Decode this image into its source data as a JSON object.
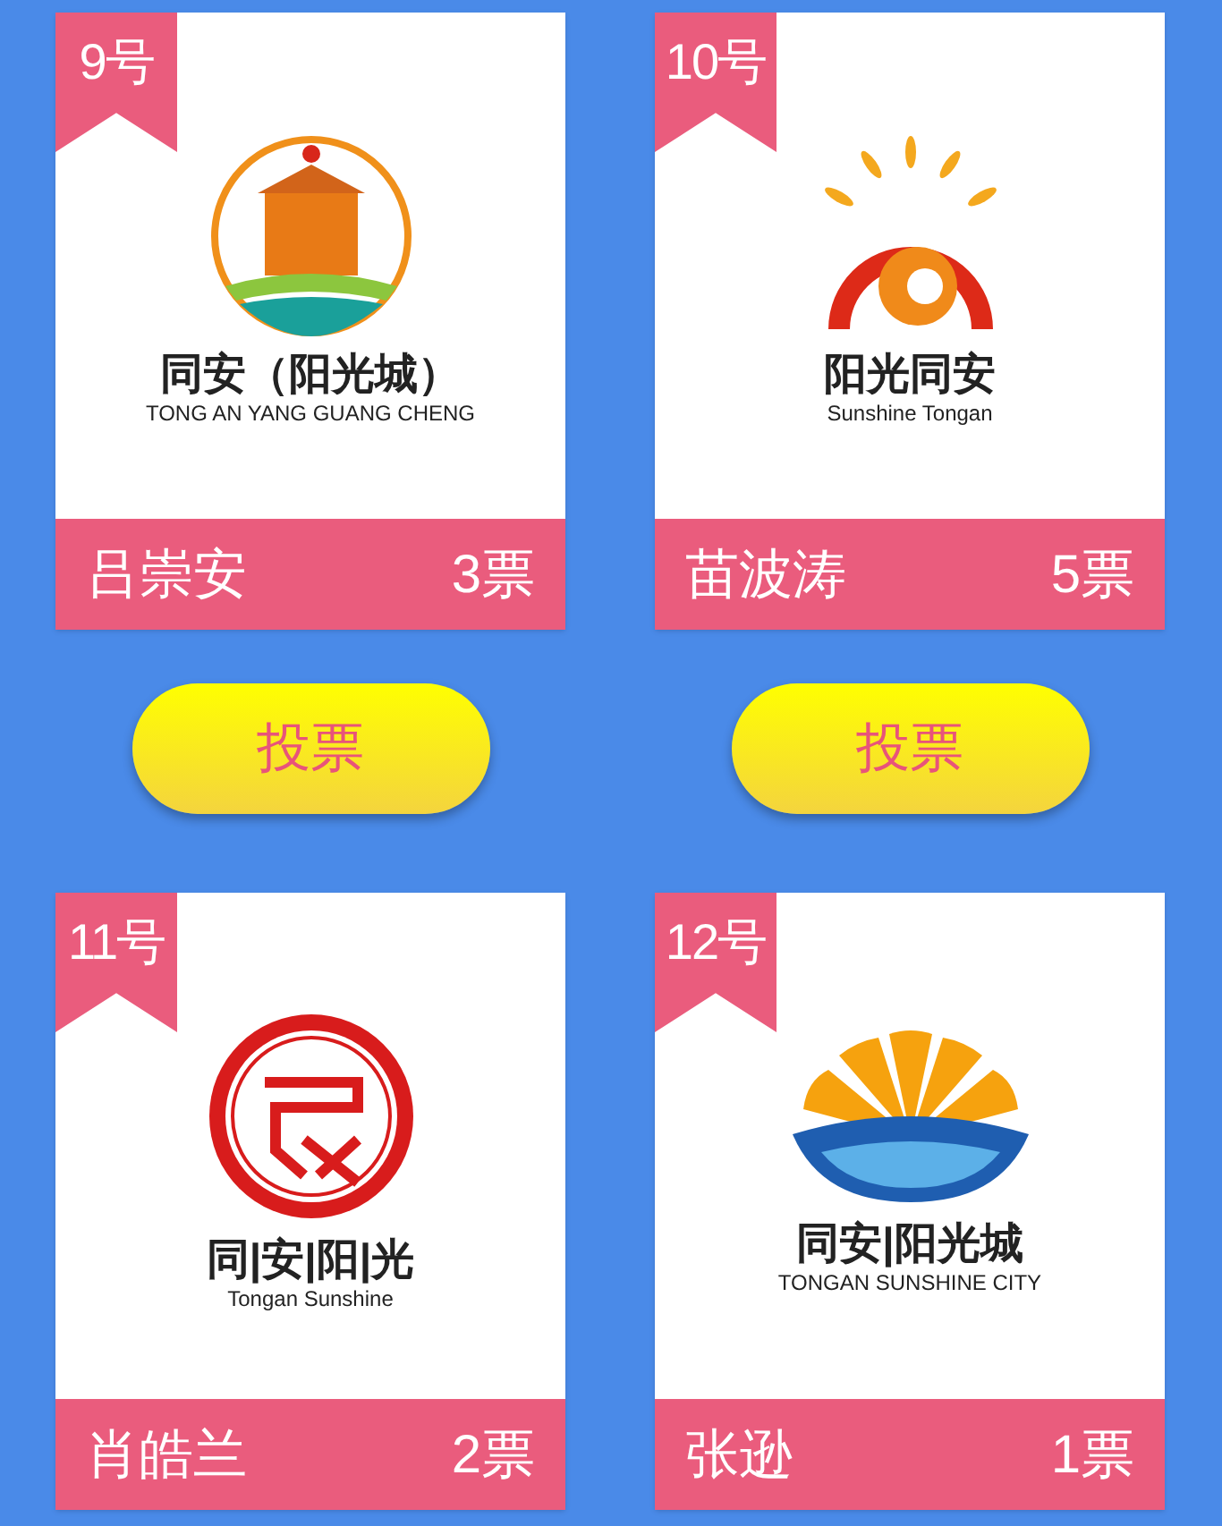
{
  "entries": [
    {
      "number": "9号",
      "logo": {
        "kind": "circle-emblem",
        "title": "同安（阳光城）",
        "subtitle": "TONG AN YANG GUANG CHENG"
      },
      "name": "吕崇安",
      "votes": "3票",
      "button": "投票"
    },
    {
      "number": "10号",
      "logo": {
        "kind": "sun-swirl",
        "title": "阳光同安",
        "subtitle": "Sunshine Tongan"
      },
      "name": "苗波涛",
      "votes": "5票",
      "button": "投票"
    },
    {
      "number": "11号",
      "logo": {
        "kind": "seal",
        "title": "同|安|阳|光",
        "subtitle": "Tongan Sunshine"
      },
      "name": "肖皓兰",
      "votes": "2票"
    },
    {
      "number": "12号",
      "logo": {
        "kind": "fan-sun",
        "title": "同安|阳光城",
        "subtitle": "TONGAN SUNSHINE CITY"
      },
      "name": "张逊",
      "votes": "1票"
    }
  ]
}
